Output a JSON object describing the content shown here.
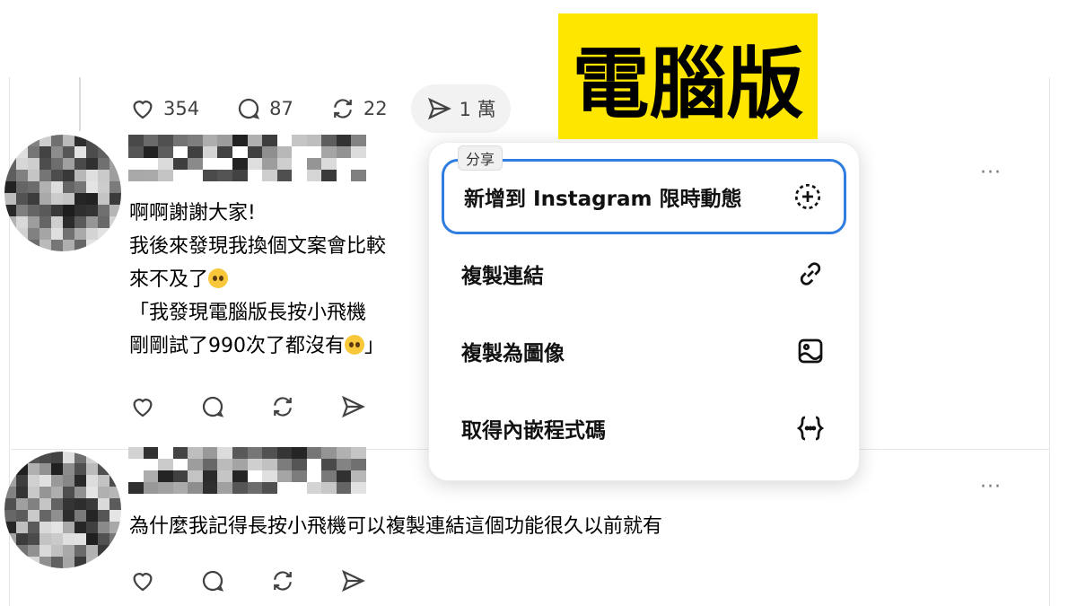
{
  "post_actions": {
    "likes": "354",
    "comments": "87",
    "reposts": "22",
    "shares": "1 萬"
  },
  "reply1": {
    "lines": [
      "啊啊謝謝大家!",
      "我後來發現我換個文案會比較",
      "來不及了",
      "「我發現電腦版長按小飛機",
      "剛剛試了990次了都沒有"
    ],
    "line5_tail": "」"
  },
  "reply2": {
    "text": "為什麼我記得長按小飛機可以複製連結這個功能很久以前就有"
  },
  "share_menu": {
    "tooltip": "分享",
    "items": [
      {
        "label": "新增到 Instagram 限時動態",
        "icon": "add-to-story-icon"
      },
      {
        "label": "複製連結",
        "icon": "link-icon"
      },
      {
        "label": "複製為圖像",
        "icon": "image-icon"
      },
      {
        "label": "取得內嵌程式碼",
        "icon": "embed-code-icon"
      }
    ]
  },
  "badge": {
    "text": "電腦版"
  },
  "more_label": "···",
  "colors": {
    "badge_bg": "#ffe600",
    "selected_border": "#2f7de1",
    "icon_gray": "#424242"
  }
}
